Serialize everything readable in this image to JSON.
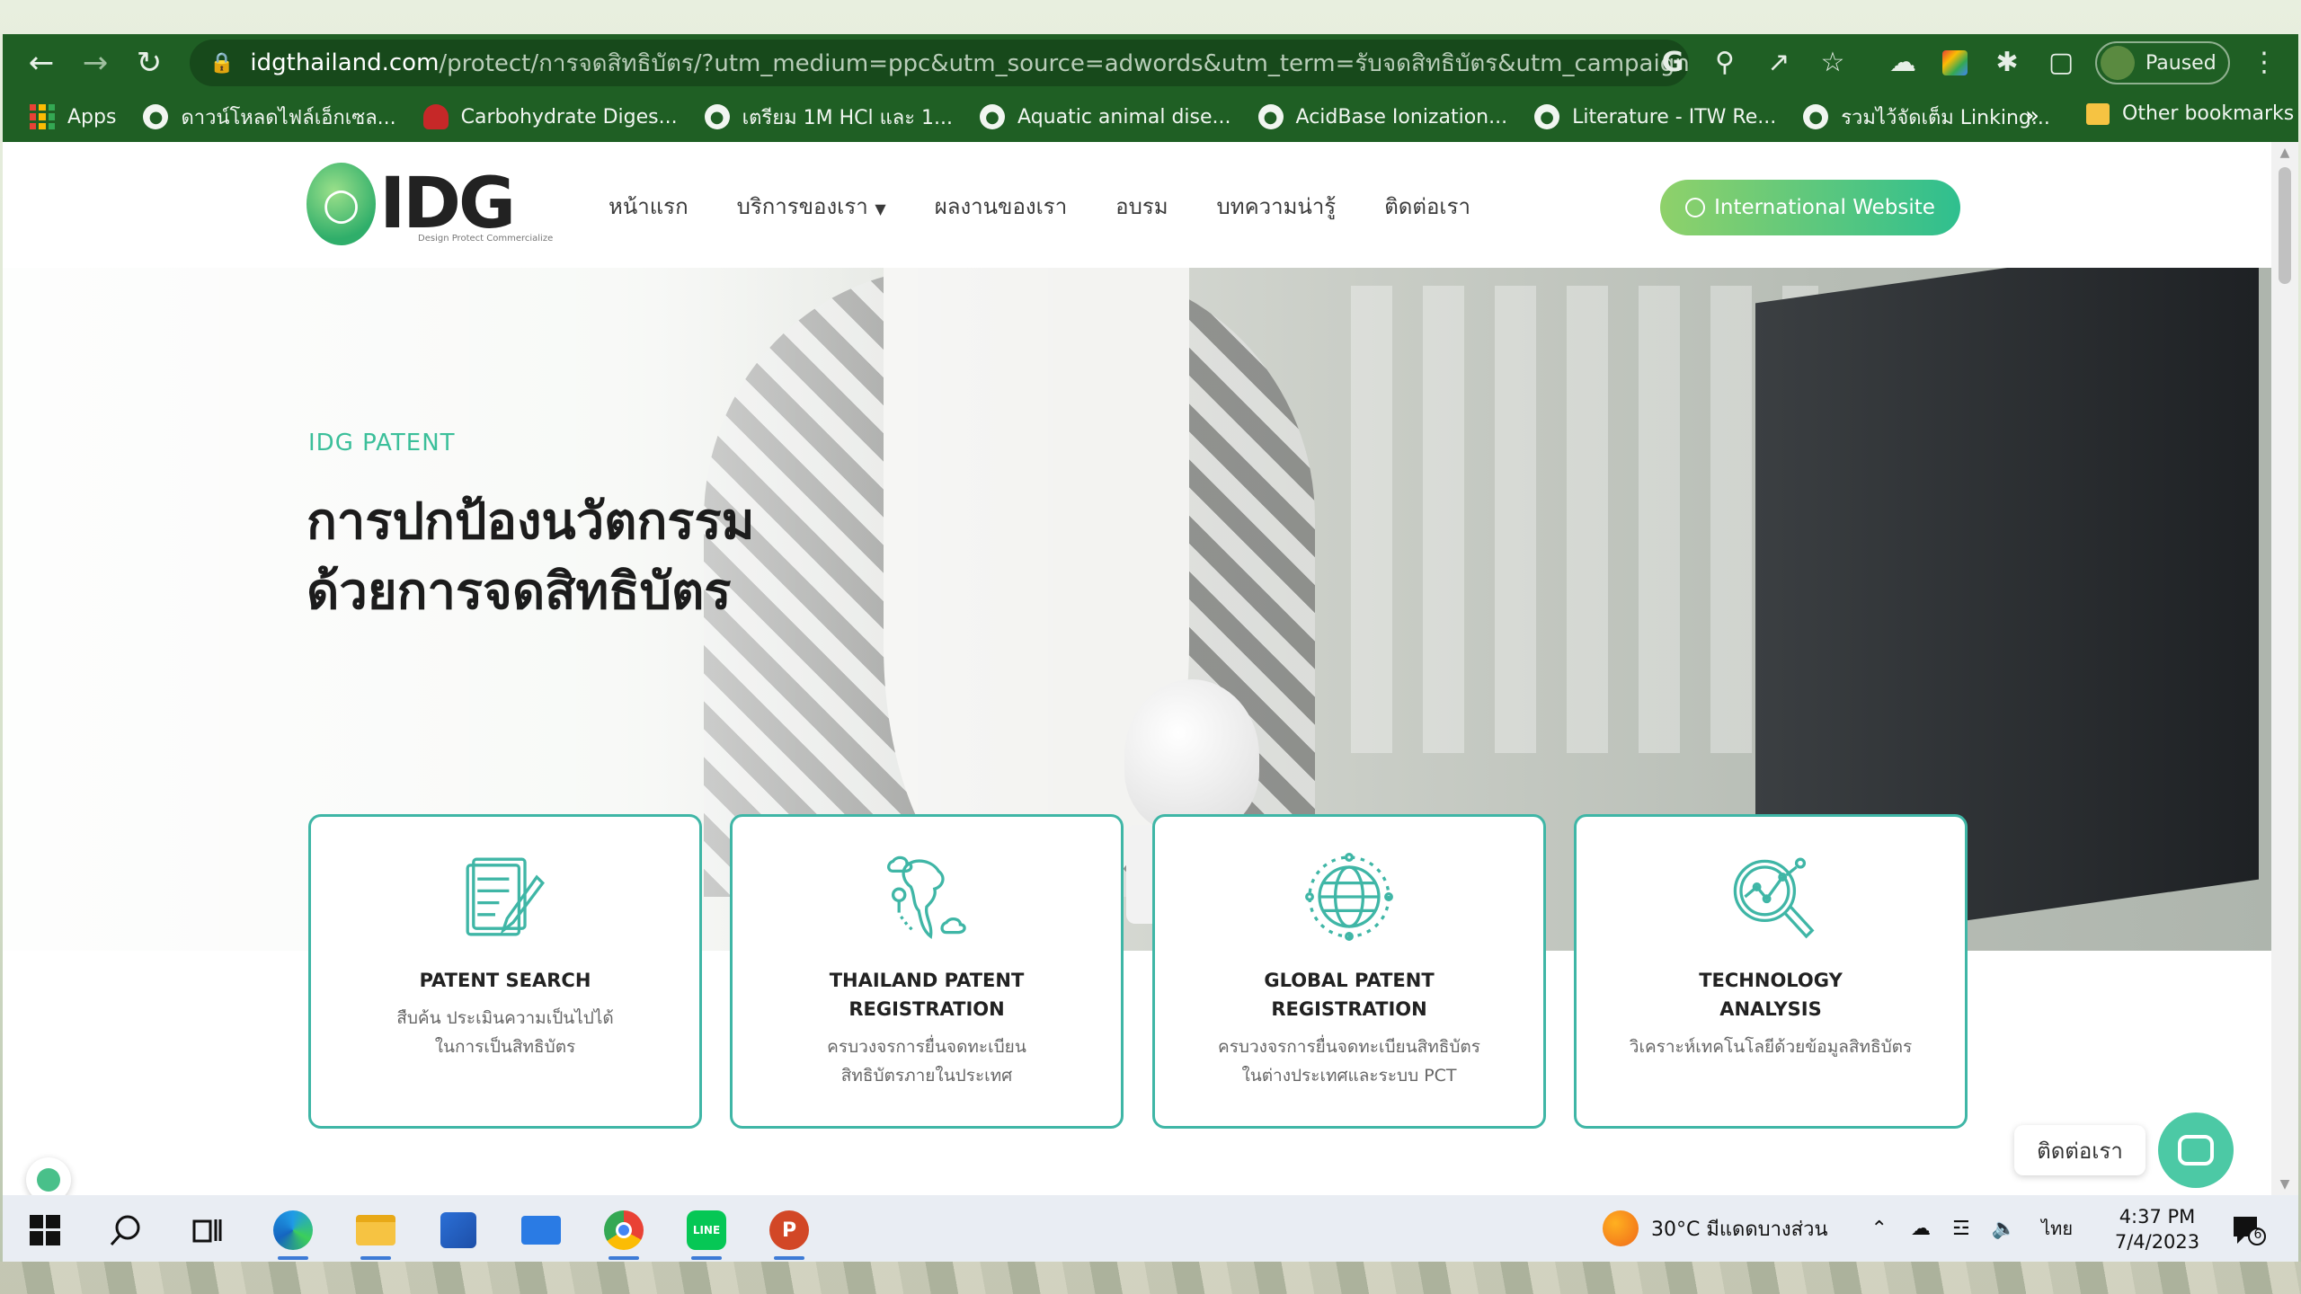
{
  "browser": {
    "url_host": "idgthailand.com",
    "url_path": "/protect/การจดสิทธิบัตร/?utm_medium=ppc&utm_source=adwords&utm_term=รับจดสิทธิบัตร&utm_campaign=Patent...",
    "profile_label": "Paused",
    "bookmarks": [
      "Apps",
      "ดาวน์โหลดไฟล์เอ็กเซล...",
      "Carbohydrate Diges...",
      "เตรียม 1M HCl และ 1...",
      "Aquatic animal dise...",
      "AcidBase Ionization...",
      "Literature - ITW Re...",
      "รวมไว้จัดเต็ม Linking..."
    ],
    "bookmarks_more": "»",
    "other_bookmarks": "Other bookmarks"
  },
  "site": {
    "logo_text": "IDG",
    "logo_tagline": "Design Protect Commercialize",
    "nav": [
      "หน้าแรก",
      "บริการของเรา",
      "ผลงานของเรา",
      "อบรม",
      "บทความน่ารู้",
      "ติดต่อเรา"
    ],
    "nav_dropdown_index": 1,
    "international_button": "International Website",
    "hero": {
      "kicker": "IDG PATENT",
      "title_line1": "การปกป้องนวัตกรรม",
      "title_line2": "ด้วยการจดสิทธิบัตร"
    },
    "services": [
      {
        "icon": "document-pen-icon",
        "title_line1": "PATENT SEARCH",
        "title_line2": "",
        "desc_line1": "สืบค้น ประเมินความเป็นไปได้",
        "desc_line2": "ในการเป็นสิทธิบัตร"
      },
      {
        "icon": "thailand-map-icon",
        "title_line1": "THAILAND PATENT",
        "title_line2": "REGISTRATION",
        "desc_line1": "ครบวงจรการยื่นจดทะเบียน",
        "desc_line2": "สิทธิบัตรภายในประเทศ"
      },
      {
        "icon": "globe-icon",
        "title_line1": "GLOBAL PATENT",
        "title_line2": "REGISTRATION",
        "desc_line1": "ครบวงจรการยื่นจดทะเบียนสิทธิบัตร",
        "desc_line2": "ในต่างประเทศและระบบ PCT"
      },
      {
        "icon": "magnifier-chart-icon",
        "title_line1": "TECHNOLOGY",
        "title_line2": "ANALYSIS",
        "desc_line1": "วิเคราะห์เทคโนโลยีด้วยข้อมูลสิทธิบัตร",
        "desc_line2": ""
      }
    ],
    "contact_label": "ติดต่อเรา"
  },
  "taskbar": {
    "weather": "30°C  มีแดดบางส่วน",
    "language": "ไทย",
    "time": "4:37 PM",
    "date": "7/4/2023",
    "notifications": "6"
  },
  "colors": {
    "accent": "#3fb6a6",
    "chrome": "#1f5f24",
    "button_start": "#8fd16a",
    "button_end": "#2fbf8f"
  }
}
